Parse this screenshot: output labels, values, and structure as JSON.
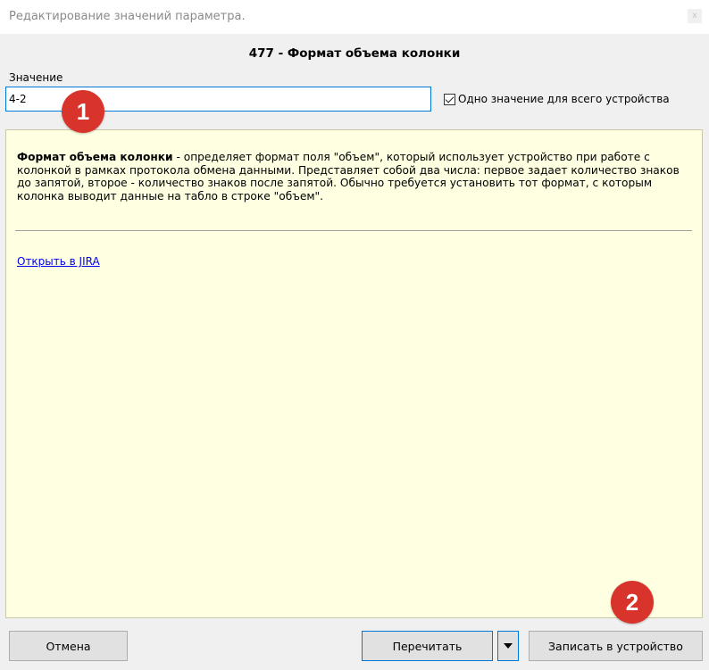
{
  "window": {
    "title": "Редактирование значений параметра.",
    "close_glyph": "x"
  },
  "param": {
    "title": "477 - Формат объема колонки"
  },
  "value": {
    "label": "Значение",
    "current": "4-2"
  },
  "checkbox": {
    "label": "Одно значение для всего устройства",
    "checked": true
  },
  "description": {
    "term": "Формат объема колонки",
    "text": " - определяет формат поля \"объем\", который использует устройство при работе с колонкой в рамках протокола обмена данными. Представляет собой два числа: первое задает количество знаков до запятой, второе - количество знаков после запятой. Обычно требуется установить тот формат, с которым колонка выводит данные на табло в строке \"объем\".",
    "link": "Открыть в JIRA",
    "background": "#ffffe1"
  },
  "buttons": {
    "cancel": "Отмена",
    "reread": "Перечитать",
    "write": "Записать в устройство"
  },
  "annotations": {
    "badge1": "1",
    "badge2": "2",
    "color": "#d9342b"
  }
}
